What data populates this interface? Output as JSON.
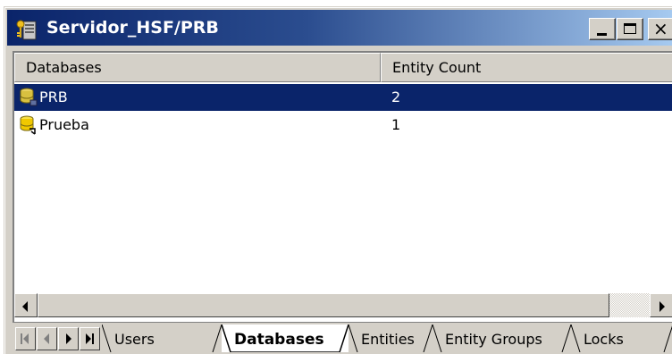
{
  "window": {
    "title": "Servidor_HSF/PRB",
    "title_icon": "server-key-icon",
    "buttons": {
      "minimize": "minimize-icon",
      "maximize": "maximize-icon",
      "close": "close-icon",
      "close_glyph": "×"
    }
  },
  "list": {
    "columns": [
      "Databases",
      "Entity Count"
    ],
    "rows": [
      {
        "name": "PRB",
        "count": "2",
        "icon": "database-icon",
        "selected": true
      },
      {
        "name": "Prueba",
        "count": "1",
        "icon": "database-icon",
        "selected": false
      }
    ]
  },
  "tabs": {
    "items": [
      "Users",
      "Databases",
      "Entities",
      "Entity Groups",
      "Locks"
    ],
    "active": "Databases"
  },
  "colors": {
    "title_start": "#0a246a",
    "title_end": "#a6caf0",
    "selection": "#0a246a",
    "face": "#d4d0c8"
  }
}
